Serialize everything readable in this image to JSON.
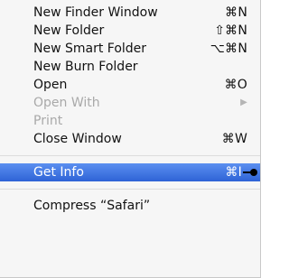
{
  "menu": {
    "items": [
      {
        "label": "New Finder Window",
        "shortcut": "⌘N",
        "enabled": true
      },
      {
        "label": "New Folder",
        "shortcut": "⇧⌘N",
        "enabled": true
      },
      {
        "label": "New Smart Folder",
        "shortcut": "⌥⌘N",
        "enabled": true
      },
      {
        "label": "New Burn Folder",
        "shortcut": "",
        "enabled": true
      },
      {
        "label": "Open",
        "shortcut": "⌘O",
        "enabled": true
      },
      {
        "label": "Open With",
        "shortcut": "▶",
        "enabled": false,
        "submenu": true
      },
      {
        "label": "Print",
        "shortcut": "",
        "enabled": false
      },
      {
        "label": "Close Window",
        "shortcut": "⌘W",
        "enabled": true
      },
      {
        "label": "Get Info",
        "shortcut": "⌘I",
        "enabled": true,
        "selected": true
      },
      {
        "label": "Compress “Safari”",
        "shortcut": "",
        "enabled": true
      }
    ]
  },
  "colors": {
    "menu_bg": "#f6f6f6",
    "selection": "#3f71d5",
    "disabled_text": "#a9a9a9"
  }
}
